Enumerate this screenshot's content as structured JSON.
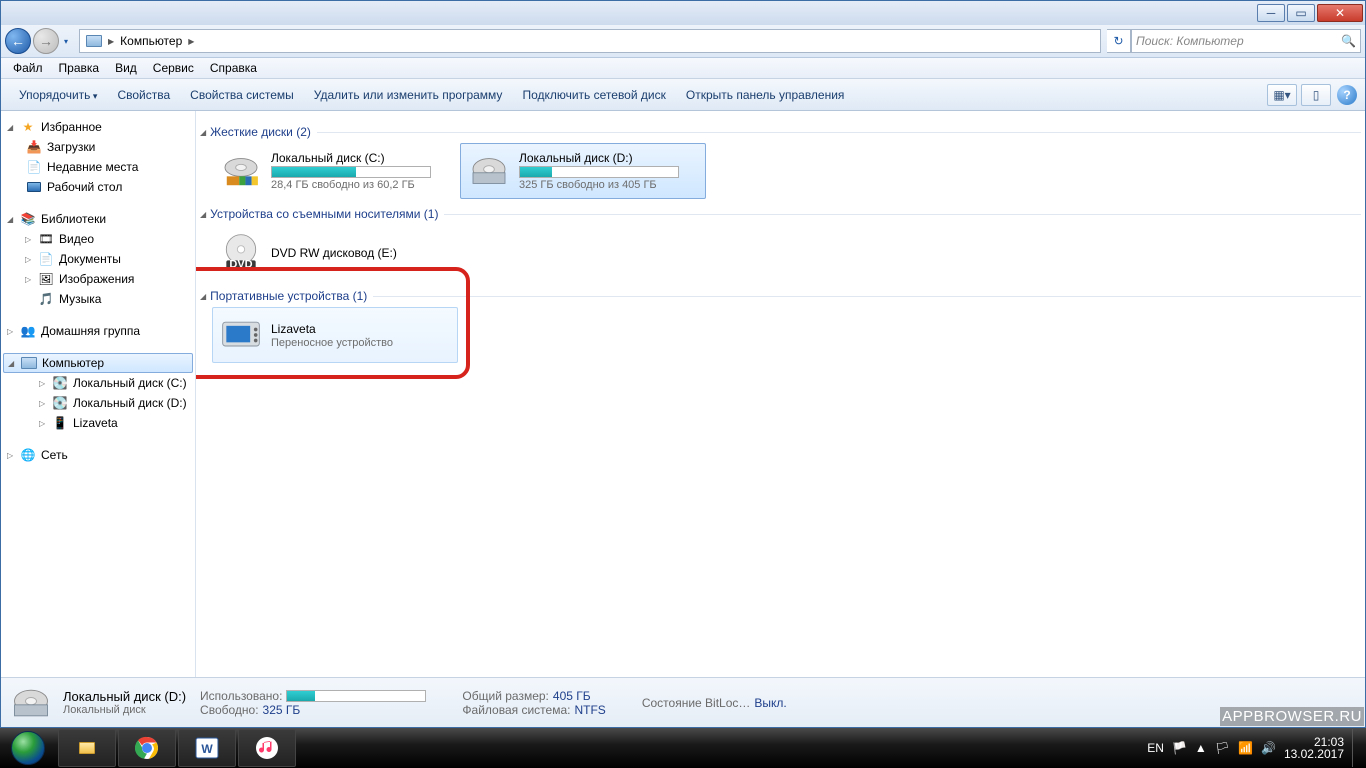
{
  "addressbar": {
    "root_label": "Компьютер"
  },
  "search": {
    "placeholder": "Поиск: Компьютер"
  },
  "menubar": {
    "file": "Файл",
    "edit": "Правка",
    "view": "Вид",
    "tools": "Сервис",
    "help": "Справка"
  },
  "cmdbar": {
    "organize": "Упорядочить",
    "properties": "Свойства",
    "sys_properties": "Свойства системы",
    "uninstall": "Удалить или изменить программу",
    "map_drive": "Подключить сетевой диск",
    "control_panel": "Открыть панель управления"
  },
  "sidebar": {
    "favorites": {
      "label": "Избранное",
      "downloads": "Загрузки",
      "recent": "Недавние места",
      "desktop": "Рабочий стол"
    },
    "libraries": {
      "label": "Библиотеки",
      "video": "Видео",
      "documents": "Документы",
      "pictures": "Изображения",
      "music": "Музыка"
    },
    "homegroup": "Домашняя группа",
    "computer": {
      "label": "Компьютер",
      "drive_c": "Локальный диск (C:)",
      "drive_d": "Локальный диск (D:)",
      "lizaveta": "Lizaveta"
    },
    "network": "Сеть"
  },
  "content": {
    "hdd": {
      "header": "Жесткие диски (2)",
      "c": {
        "name": "Локальный диск (C:)",
        "sub": "28,4 ГБ свободно из 60,2 ГБ",
        "fill": 53
      },
      "d": {
        "name": "Локальный диск (D:)",
        "sub": "325 ГБ свободно из 405 ГБ",
        "fill": 20
      }
    },
    "removable": {
      "header": "Устройства со съемными носителями (1)",
      "dvd": {
        "name": "DVD RW дисковод (E:)"
      }
    },
    "portable": {
      "header": "Портативные устройства (1)",
      "liz": {
        "name": "Lizaveta",
        "sub": "Переносное устройство"
      }
    }
  },
  "details": {
    "title": "Локальный диск (D:)",
    "type": "Локальный диск",
    "used_lbl": "Использовано:",
    "used_fill": 20,
    "total_lbl": "Общий размер:",
    "total_val": "405 ГБ",
    "free_lbl": "Свободно:",
    "free_val": "325 ГБ",
    "fs_lbl": "Файловая система:",
    "fs_val": "NTFS",
    "bl_lbl": "Состояние BitLoc…",
    "bl_val": "Выкл."
  },
  "taskbar": {
    "lang": "EN",
    "time": "21:03",
    "date": "13.02.2017"
  },
  "watermark": "APPBROWSER.RU"
}
